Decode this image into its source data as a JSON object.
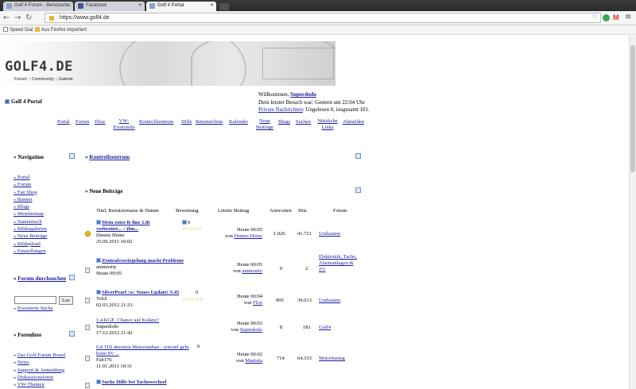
{
  "browser": {
    "tabs": [
      {
        "label": "Golf 4 Forum - Benutzerk...",
        "active": false
      },
      {
        "label": "Facebook",
        "active": false
      },
      {
        "label": "Golf 4 Portal",
        "active": true
      }
    ],
    "url": "https://www.golf4.de",
    "bookmarks": [
      "Speed Dial",
      "Aus Firefox importiert"
    ]
  },
  "header": {
    "logo": "GOLF4.DE",
    "tagline": "Forum :: Community :: Galerie",
    "portal_title": "Golf 4 Portal"
  },
  "welcome": {
    "greeting": "Willkommen,",
    "username": "Superdodo",
    "last_visit": "Dein letzter Besuch war: Gestern um 22:04 Uhr",
    "pm_link": "Private Nachrichten",
    "pm_status": ": Ungelesen 0, insgesamt 101."
  },
  "topnav": [
    "Portal",
    "Forum",
    "Ebay",
    "VW-Ersatzteile",
    "Kontrollzentrum",
    "Hilfe",
    "Benutzerliste",
    "Kalender",
    "Neue Beiträge",
    "Blogs",
    "Suchen",
    "Nützliche Links",
    "Abmelden"
  ],
  "sidebar": {
    "navigation_title": "» Navigation",
    "navigation_items": [
      "» Portal",
      "» Forum",
      "» Fan Shop",
      "» Banner",
      "» Blogs",
      "» Membermap",
      "» Stammtisch",
      "» Bildergalerien",
      "» Neue Beiträge",
      "» Bildupload",
      "» Einstellungen"
    ],
    "search_title": "Forum durchsuchen",
    "search_prefix": "» ",
    "search_button": "Los",
    "advanced_search": "Erweiterte Suche",
    "advanced_prefix": "» ",
    "forenliste_title": "» Forenliste",
    "forenliste_items": [
      "Das Golf Forum Board",
      "News",
      "Support & Anmeldung",
      "Diskussionsforen",
      "VW-Themen"
    ]
  },
  "main": {
    "kontrollzentrum_title": "Kontrollzentrum",
    "neue_title": "» Neue Beiträge",
    "columns": [
      "Titel, Benutzername & Datum",
      "Bewertung",
      "Letzter Beitrag",
      "Antworten",
      "Hits",
      "Forum"
    ],
    "rows": [
      {
        "title": "Mein roter R-line 1.8t verbreitet... :-)Im...",
        "user": "Dennis Heinz",
        "date": "25.06.2011 16:02",
        "rating_count": "0",
        "last_time": "Heute 00:05",
        "last_by": "Dennis Heinz",
        "answers": "1.026",
        "hits": "41.721",
        "forum": "Umbauten",
        "bold": true
      },
      {
        "title": "Zentralverriegelung macht Probleme",
        "user": "animosity",
        "date": "Heute 00:05",
        "rating_count": "",
        "last_time": "Heute 00:05",
        "last_by": "animosity",
        "answers": "0",
        "hits": "2",
        "forum": "Elektronik, Tacho, Alarmanlagen & ZV",
        "bold": true
      },
      {
        "title": "SilverPearl :w: Neues Update! S.45",
        "user": "TobZ",
        "date": "02.03.2012 21:33",
        "rating_count": "0",
        "last_time": "Heute 00:04",
        "last_by": "Floo",
        "answers": "905",
        "hits": "39.013",
        "forum": "Umbauten",
        "bold": true
      },
      {
        "title": "1.4 KGE. Chance auf Kulanz?",
        "user": "Superdodo",
        "date": "17.12.2012 21:42",
        "rating_count": "",
        "last_time": "Heute 00:03",
        "last_by": "Superdodo",
        "answers": "8",
        "hits": "181",
        "forum": "Golf4",
        "bold": false
      },
      {
        "title": "G4 TDI 4motion Motorumbau - wieviel geht beim 8V ...",
        "user": "Fab176",
        "date": "11.01.2011 10:31",
        "rating_count": "0",
        "last_time": "Heute 00:02",
        "last_by": "Mantafa",
        "answers": "714",
        "hits": "64.333",
        "forum": "Motortuning",
        "bold": false
      },
      {
        "title": "Suche Hilfe bei Tachowechsel",
        "user": "",
        "date": "",
        "rating_count": "",
        "last_time": "",
        "last_by": "",
        "answers": "",
        "hits": "",
        "forum": "",
        "bold": true
      }
    ],
    "von_label": "von"
  }
}
